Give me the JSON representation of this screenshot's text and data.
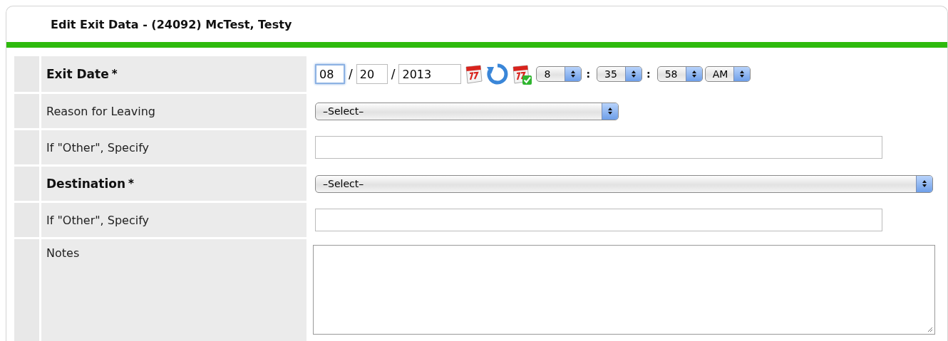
{
  "title": "Edit Exit Data - (24092) McTest, Testy",
  "rows": [
    {
      "kind": "datetime",
      "label": "Exit Date",
      "required_mark": "*",
      "date_parts": [
        {
          "kind": "field",
          "value": "08",
          "focused": true
        },
        {
          "kind": "sep",
          "text": "/"
        },
        {
          "kind": "field",
          "value": "20",
          "focused": false
        },
        {
          "kind": "sep",
          "text": "/"
        },
        {
          "kind": "field",
          "value": "2013",
          "focused": false
        }
      ],
      "time_parts": [
        {
          "kind": "select",
          "value": "8"
        },
        {
          "kind": "sep",
          "text": ":"
        },
        {
          "kind": "select",
          "value": "35"
        },
        {
          "kind": "sep",
          "text": ":"
        },
        {
          "kind": "select",
          "value": "58"
        },
        {
          "kind": "select",
          "value": "AM"
        }
      ]
    },
    {
      "kind": "select_short",
      "label": "Reason for Leaving",
      "value": "–Select–"
    },
    {
      "kind": "text",
      "label": "If \"Other\", Specify"
    },
    {
      "kind": "select_full",
      "label": "Destination",
      "required_mark": "*",
      "value": "–Select–"
    },
    {
      "kind": "text",
      "label": "If \"Other\", Specify"
    },
    {
      "kind": "textarea",
      "label": "Notes"
    }
  ]
}
